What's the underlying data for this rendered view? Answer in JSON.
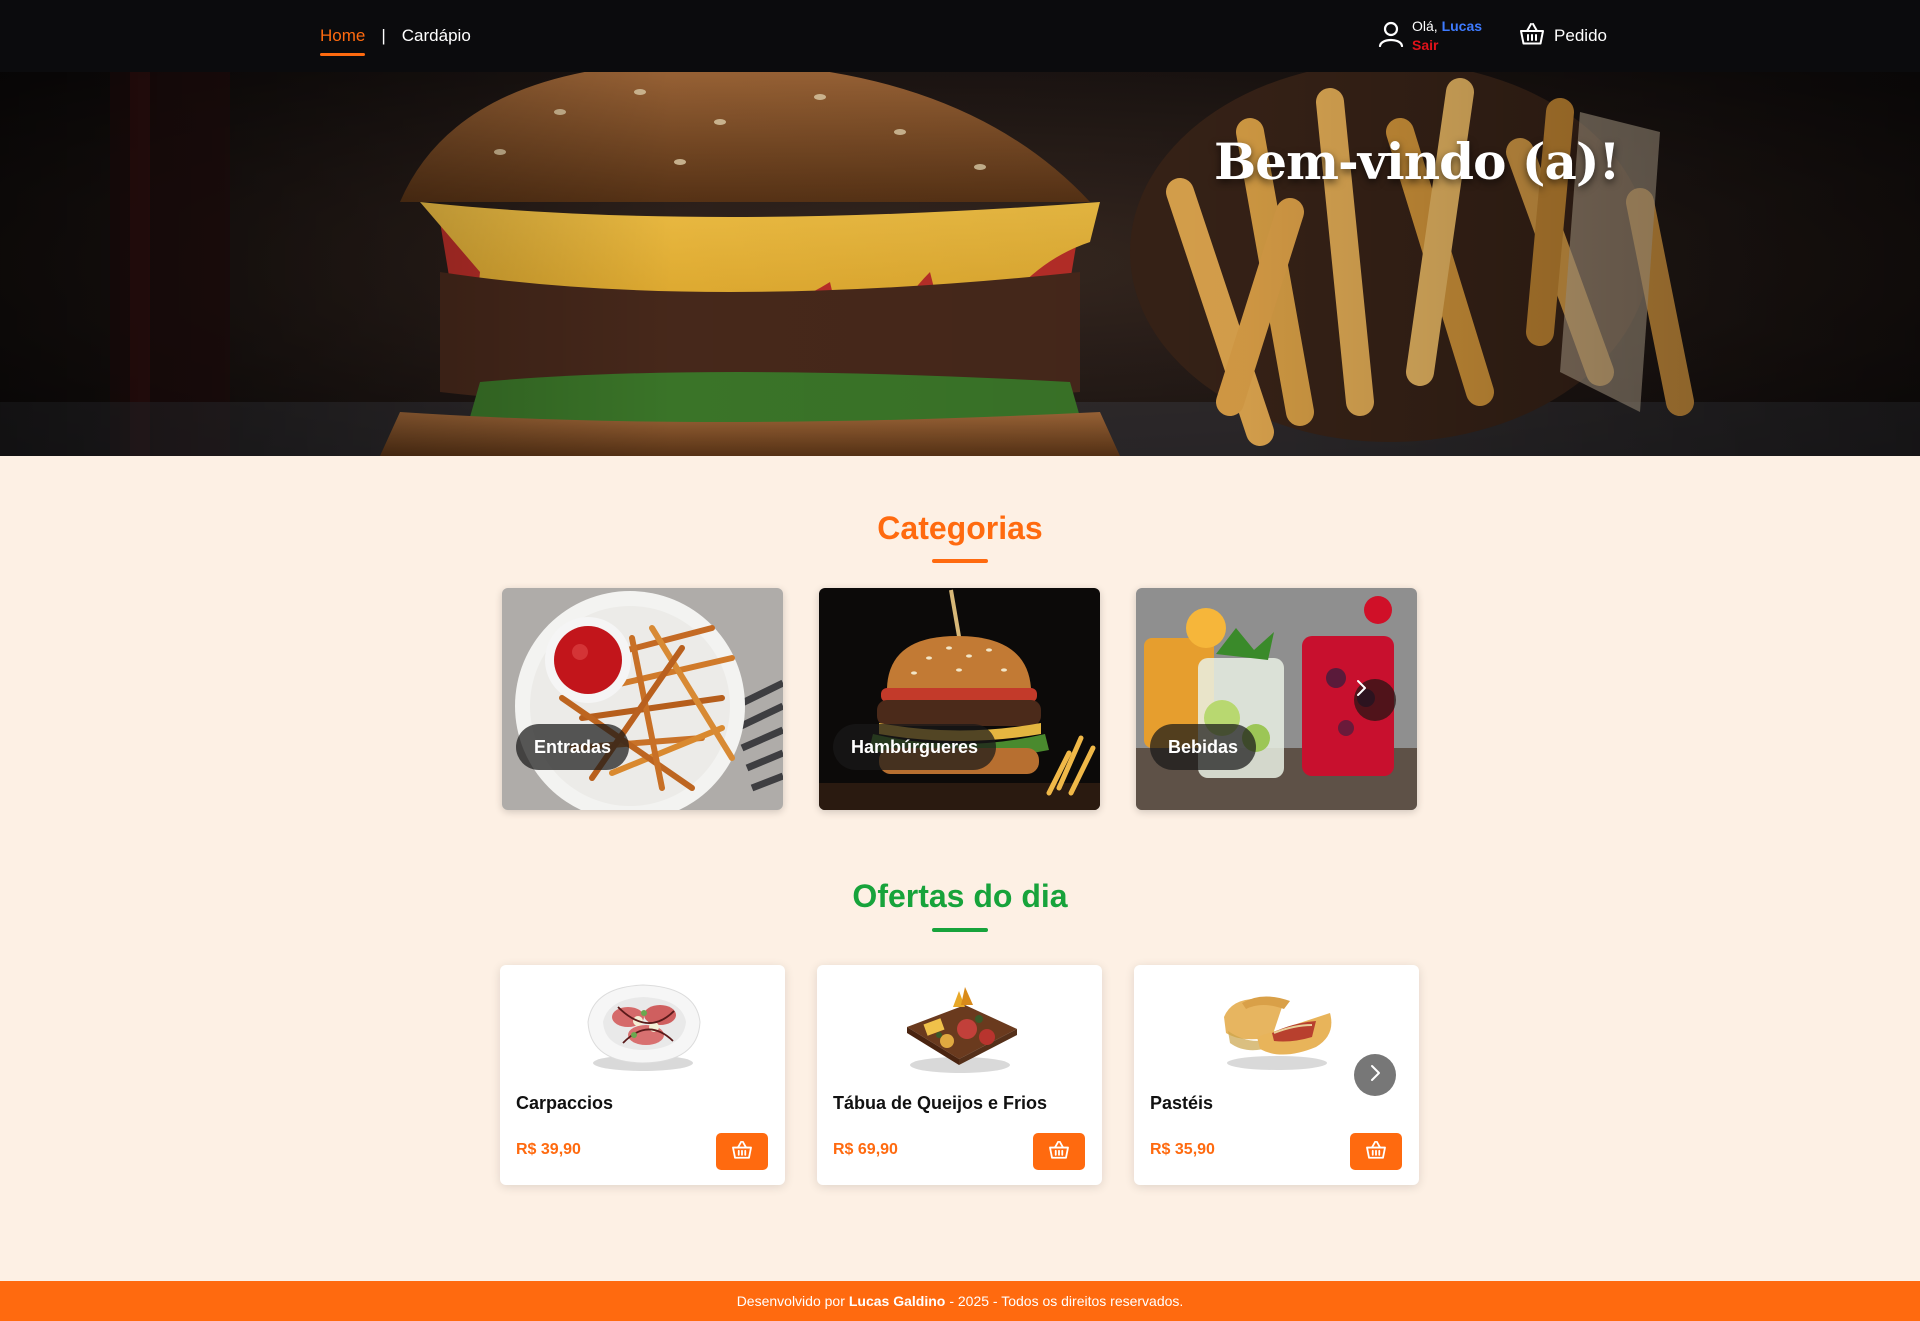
{
  "nav": {
    "links": [
      {
        "label": "Home",
        "active": true
      },
      {
        "label": "Cardápio",
        "active": false
      }
    ],
    "separator": "|",
    "user": {
      "greeting": "Olá,",
      "name": "Lucas",
      "logout": "Sair",
      "icon": "user-icon"
    },
    "order": {
      "label": "Pedido",
      "icon": "basket-icon"
    }
  },
  "hero": {
    "title": "Bem-vindo (a)!"
  },
  "categories": {
    "title": "Categorias",
    "items": [
      {
        "label": "Entradas",
        "image": "fries-with-ketchup"
      },
      {
        "label": "Hambúrgueres",
        "image": "burger"
      },
      {
        "label": "Bebidas",
        "image": "drinks"
      }
    ],
    "next_icon": "chevron-right-icon"
  },
  "offers": {
    "title": "Ofertas do dia",
    "items": [
      {
        "name": "Carpaccios",
        "price": "R$ 39,90",
        "image": "carpaccio-plate"
      },
      {
        "name": "Tábua de Queijos e Frios",
        "price": "R$ 69,90",
        "image": "cheese-board"
      },
      {
        "name": "Pastéis",
        "price": "R$ 35,90",
        "image": "pasteis"
      }
    ],
    "cart_icon": "basket-icon",
    "next_icon": "chevron-right-icon"
  },
  "footer": {
    "prefix": "Desenvolvido por",
    "author": "Lucas Galdino",
    "suffix": "- 2025 - Todos os direitos reservados."
  },
  "colors": {
    "accent": "#ff6a0f",
    "offers_green": "#17a33b",
    "nav_bg": "#0b0b0d",
    "page_bg": "#fdf0e4",
    "user_name": "#3e7bff",
    "logout": "#e0121a"
  }
}
